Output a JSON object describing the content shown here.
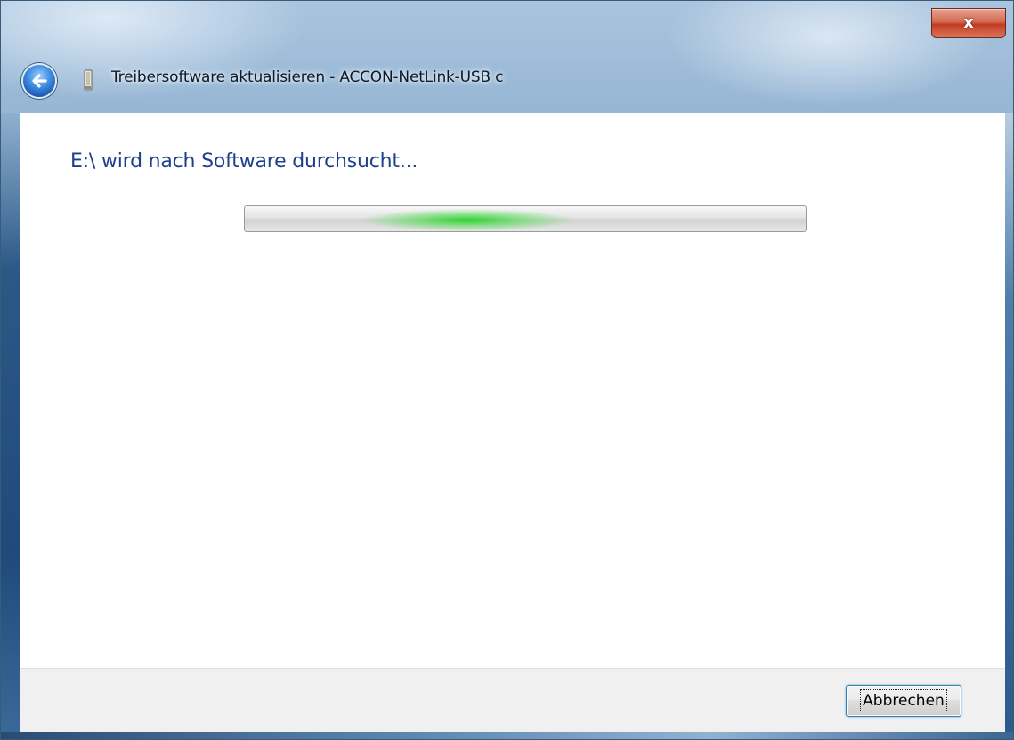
{
  "window": {
    "title": "Treibersoftware aktualisieren - ACCON-NetLink-USB c",
    "close_glyph": "x",
    "back_icon": "back-arrow-icon",
    "device_icon": "usb-device-icon"
  },
  "main": {
    "heading": "E:\\ wird nach Software durchsucht...",
    "progress": {
      "state": "indeterminate",
      "color": "#2ecc40"
    }
  },
  "footer": {
    "cancel_label": "Abbrechen"
  },
  "colors": {
    "heading": "#1e3f8c",
    "frame": "#4b77a6",
    "close": "#c23b22",
    "footer_bg": "#f0f0f0"
  }
}
